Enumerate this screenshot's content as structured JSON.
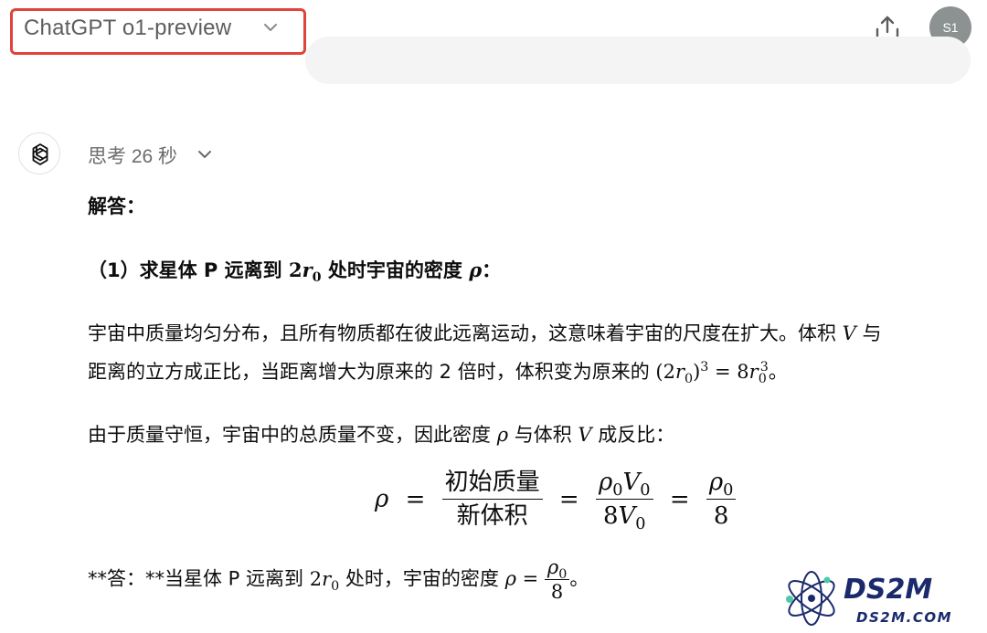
{
  "header": {
    "model_name": "ChatGPT o1-preview",
    "avatar_text": "S1"
  },
  "icons": {
    "model_dropdown": "chevron-down-icon",
    "share": "share-icon",
    "assistant": "openai-logo-icon",
    "thought_dropdown": "chevron-down-icon"
  },
  "colors": {
    "highlight_box": "#e0443a",
    "avatar_bg": "#8b9291"
  },
  "message": {
    "thought_label": "思考 26 秒",
    "answer_heading": "解答：",
    "part1": {
      "prefix": "（1）求星体 P 远离到 ",
      "r_sub": "0",
      "mid": " 处时宇宙的密度 ",
      "suffix": "："
    },
    "para1": {
      "line1_text": "宇宙中质量均匀分布，且所有物质都在彼此远离运动，这意味着宇宙的尺度在扩大。体积 ",
      "line1_end": " 与",
      "line2_text": "距离的立方成正比，当距离增大为原来的 2 倍时，体积变为原来的 ",
      "line2_end": "。"
    },
    "para2": {
      "text": "由于质量守恒，宇宙中的总质量不变，因此密度 ",
      "mid": " 与体积 ",
      "end": " 成反比："
    },
    "equation": {
      "lhs": "ρ",
      "frac1_num": "初始质量",
      "frac1_den": "新体积",
      "frac3_den": "8"
    },
    "answer_line": {
      "prefix": "**答：**当星体 P 远离到 ",
      "mid": " 处时，宇宙的密度 ",
      "frac_den": "8",
      "end": "。"
    }
  },
  "watermark": {
    "main": "DS2M",
    "sub": "DS2M.COM"
  }
}
